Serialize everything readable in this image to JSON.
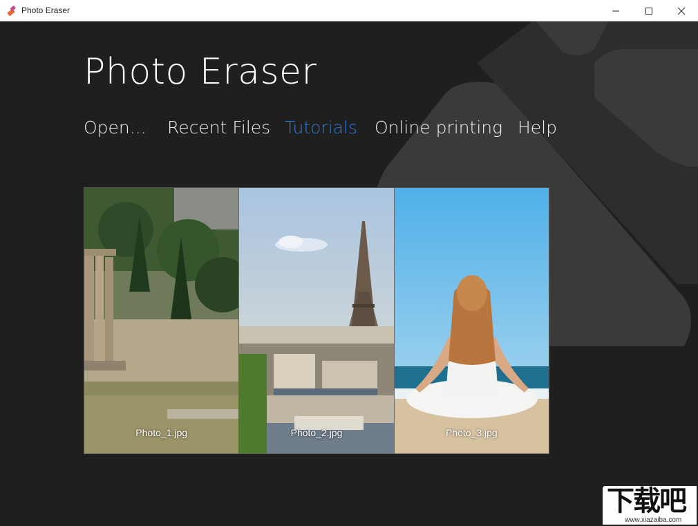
{
  "window": {
    "title": "Photo Eraser",
    "controls": {
      "minimize": "minimize-icon",
      "maximize": "maximize-icon",
      "close": "close-icon"
    }
  },
  "app": {
    "heading": "Photo Eraser"
  },
  "nav": {
    "items": [
      {
        "label": "Open...",
        "active": false
      },
      {
        "label": "Recent Files",
        "active": false
      },
      {
        "label": "Tutorials",
        "active": true
      },
      {
        "label": "Online printing",
        "active": false
      },
      {
        "label": "Help",
        "active": false
      }
    ]
  },
  "gallery": {
    "photos": [
      {
        "caption": "Photo_1.jpg",
        "scene": "ancient-ruins-columns"
      },
      {
        "caption": "Photo_2.jpg",
        "scene": "eiffel-tower-paris"
      },
      {
        "caption": "Photo_3.jpg",
        "scene": "woman-meditating-beach"
      }
    ]
  },
  "watermark": {
    "logo": "下载吧",
    "url": "www.xiazaiba.com"
  },
  "colors": {
    "background": "#1f1f1f",
    "accent": "#2f7ad6",
    "text": "#f0f0f0",
    "shape": "#3a3a3a"
  }
}
